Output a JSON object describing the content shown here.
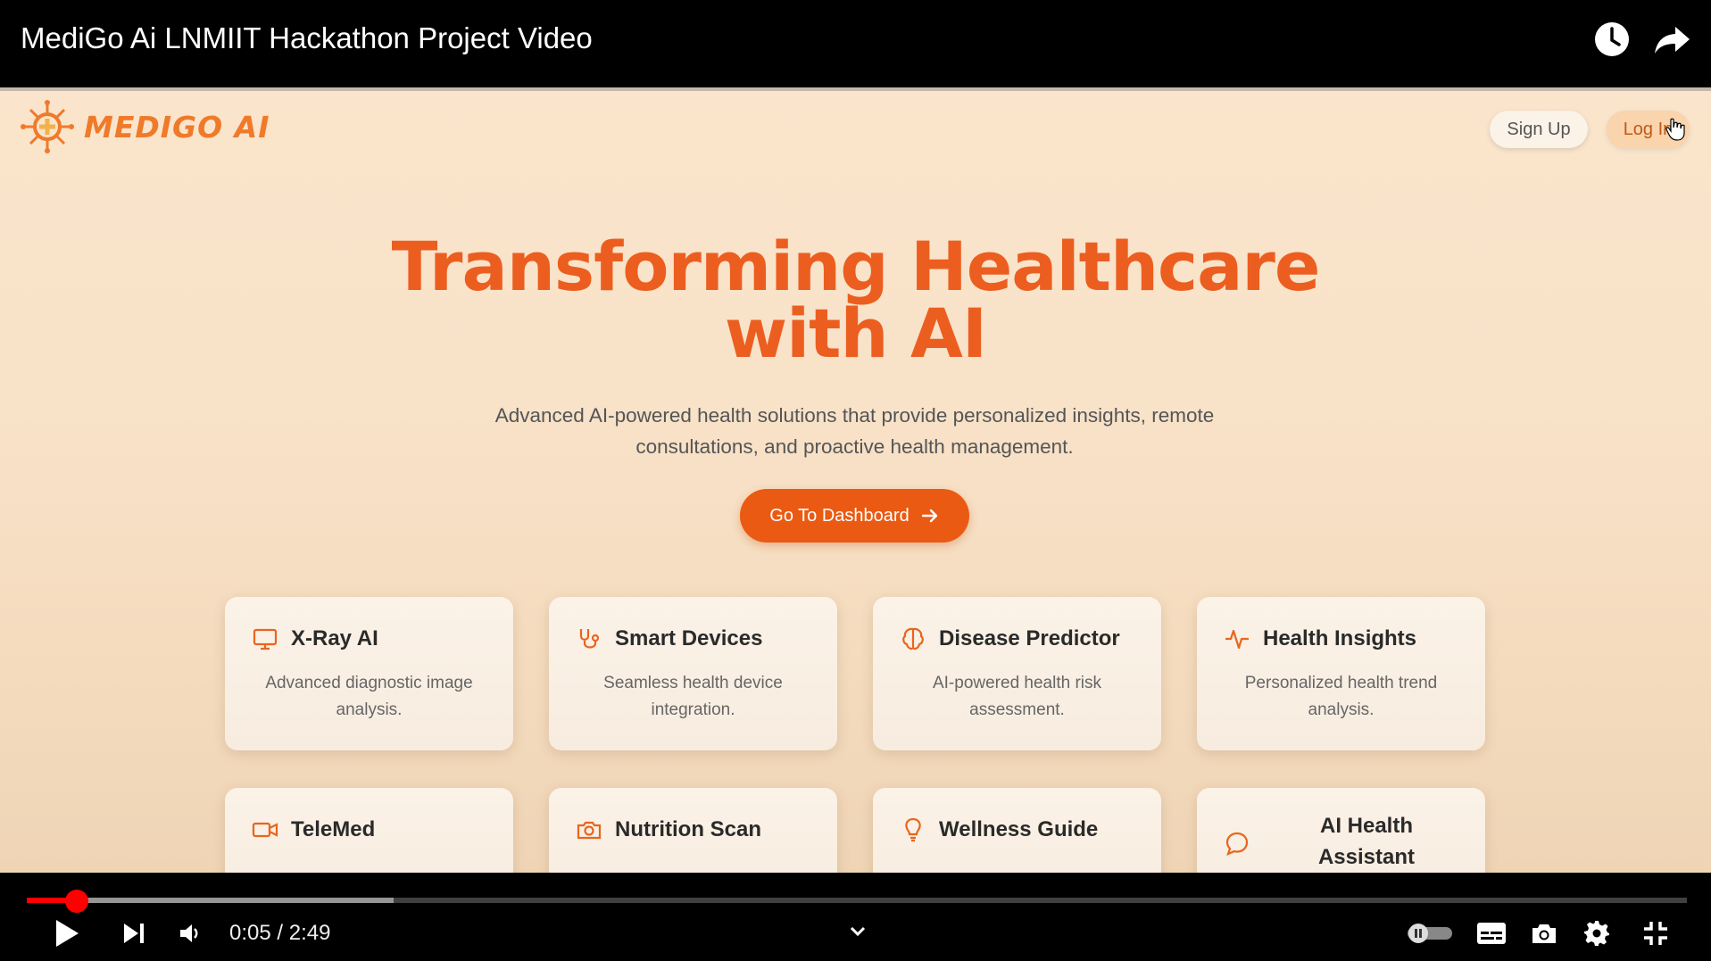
{
  "player": {
    "title": "MediGo Ai LNMIIT Hackathon Project Video",
    "time_display": "0:05 / 2:49",
    "progress_fraction": 0.03,
    "buffered_fraction": 0.221,
    "icons": [
      "clock-icon",
      "share-icon",
      "play-icon",
      "next-icon",
      "volume-icon",
      "chevron-down-icon",
      "autoplay-toggle-icon",
      "subtitles-icon",
      "camera-icon",
      "settings-icon",
      "exit-fullscreen-icon"
    ]
  },
  "site": {
    "logo_text": "MEDIGO AI",
    "nav": {
      "signup": "Sign Up",
      "login": "Log In"
    },
    "hero": {
      "title_line1": "Transforming Healthcare",
      "title_line2": "with AI",
      "subtitle": "Advanced AI-powered health solutions that provide personalized insights, remote consultations, and proactive health management.",
      "cta": "Go To Dashboard"
    },
    "cards": [
      {
        "title": "X-Ray AI",
        "desc": "Advanced diagnostic image analysis.",
        "icon": "monitor-icon"
      },
      {
        "title": "Smart Devices",
        "desc": "Seamless health device integration.",
        "icon": "stethoscope-icon"
      },
      {
        "title": "Disease Predictor",
        "desc": "AI-powered health risk assessment.",
        "icon": "brain-icon"
      },
      {
        "title": "Health Insights",
        "desc": "Personalized health trend analysis.",
        "icon": "pulse-icon"
      },
      {
        "title": "TeleMed",
        "desc": "",
        "icon": "video-icon"
      },
      {
        "title": "Nutrition Scan",
        "desc": "",
        "icon": "camera-icon"
      },
      {
        "title": "Wellness Guide",
        "desc": "",
        "icon": "lightbulb-icon"
      },
      {
        "title": "AI Health Assistant",
        "desc": "",
        "icon": "chat-icon"
      }
    ],
    "colors": {
      "accent": "#ea5a12",
      "title": "#ec5e20",
      "logo": "#ef7a2a"
    }
  }
}
